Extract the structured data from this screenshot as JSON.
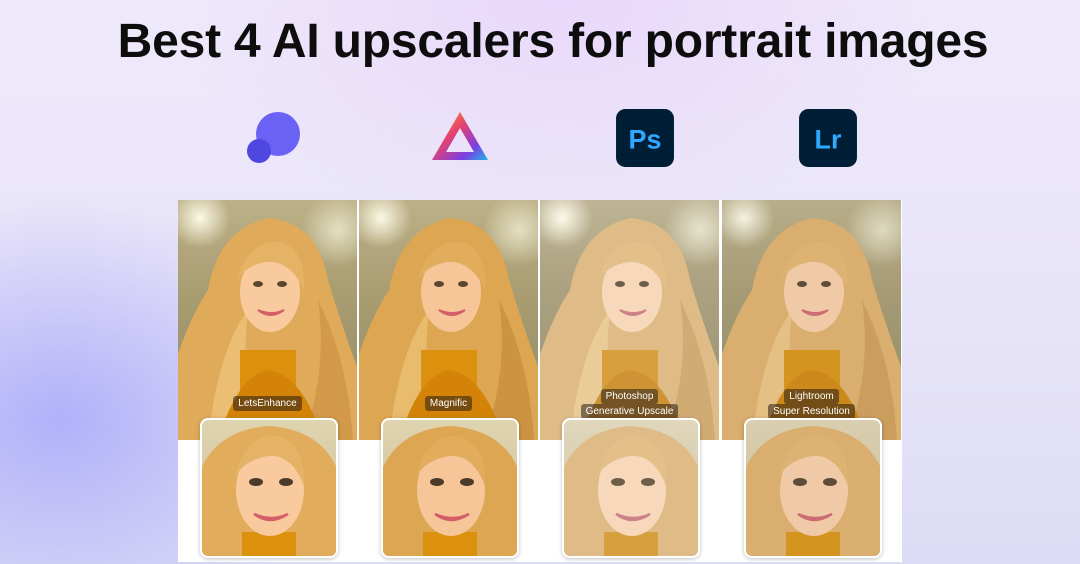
{
  "title": "Best 4 AI upscalers for portrait images",
  "logos": [
    {
      "name": "letsenhance-logo-icon",
      "color": "#5b55ee"
    },
    {
      "name": "magnific-logo-icon",
      "colors": [
        "#f2b12c",
        "#e8426b",
        "#7b3fe4",
        "#1fb5e8"
      ]
    },
    {
      "name": "photoshop-logo-icon",
      "text": "Ps",
      "bg": "#001e36",
      "fg": "#31a8ff"
    },
    {
      "name": "lightroom-logo-icon",
      "text": "Lr",
      "bg": "#001e36",
      "fg": "#31a8ff"
    }
  ],
  "panels": [
    {
      "label_line1": "LetsEnhance",
      "label_line2": ""
    },
    {
      "label_line1": "Magnific",
      "label_line2": ""
    },
    {
      "label_line1": "Photoshop",
      "label_line2": "Generative Upscale"
    },
    {
      "label_line1": "Lightroom",
      "label_line2": "Super Resolution"
    }
  ],
  "colors": {
    "hair": "#d9ad6c",
    "skin": "#f0c8a4",
    "sweater": "#d1901e"
  }
}
